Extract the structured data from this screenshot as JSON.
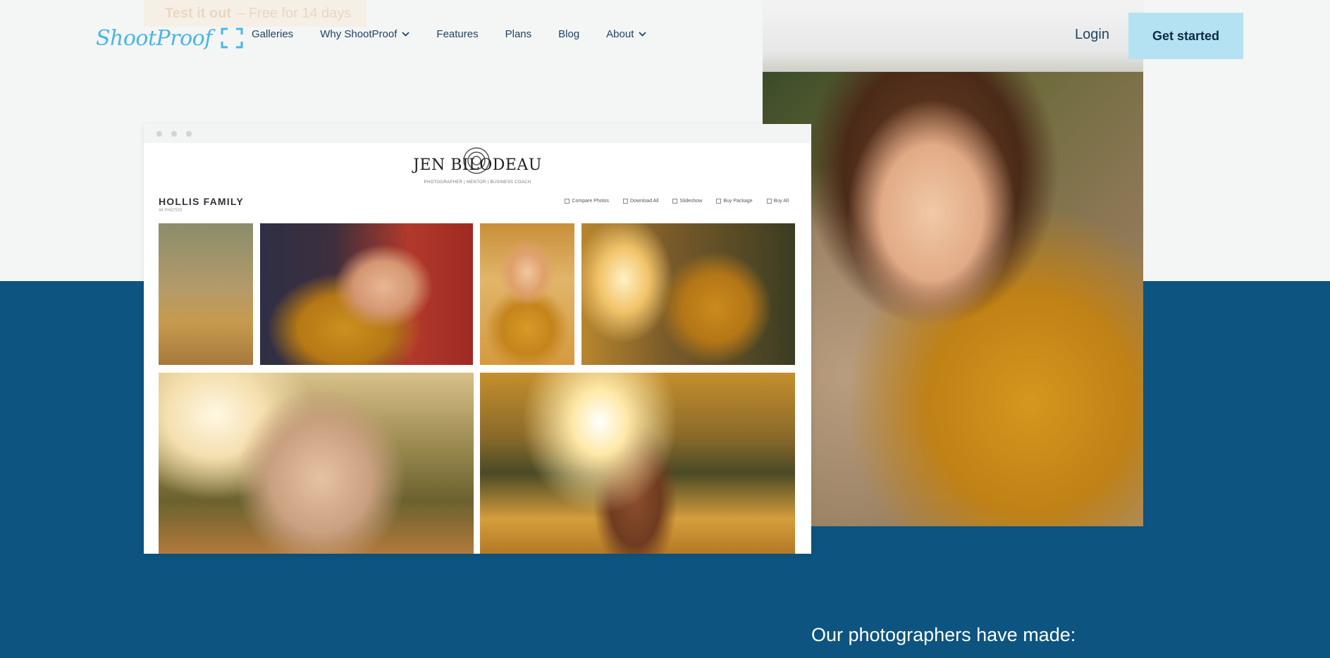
{
  "promo": {
    "label": "Test it out",
    "sub": "– Free for 14 days"
  },
  "logo": {
    "text": "ShootProof"
  },
  "nav": {
    "links": [
      {
        "label": "Galleries"
      },
      {
        "label": "Why ShootProof"
      },
      {
        "label": "Features"
      },
      {
        "label": "Plans"
      },
      {
        "label": "Blog"
      },
      {
        "label": "About"
      }
    ],
    "login": "Login",
    "cta": "Get started"
  },
  "gallery": {
    "brand": "JEN BILODEAU",
    "tagline": "PHOTOGRAPHER | MENTOR | BUSINESS COACH",
    "title": "HOLLIS FAMILY",
    "count": "44 PHOTOS",
    "actions": [
      {
        "label": "Compare Photos"
      },
      {
        "label": "Download All"
      },
      {
        "label": "Slideshow"
      },
      {
        "label": "Buy Package"
      },
      {
        "label": "Buy All"
      }
    ]
  },
  "stats": {
    "heading": "Our photographers have made:"
  },
  "colors": {
    "brand": "#48b6e6",
    "navy": "#0d5480",
    "cta": "#b5e2f2"
  }
}
